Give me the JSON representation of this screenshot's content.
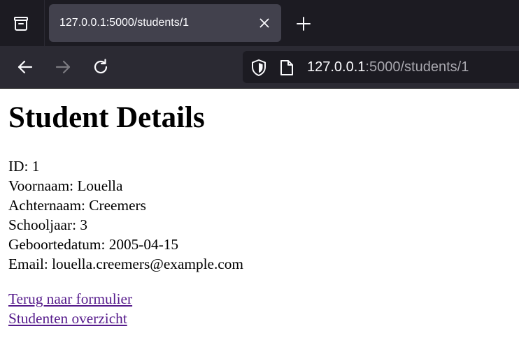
{
  "browser": {
    "tab_title": "127.0.0.1:5000/students/1",
    "url_host": "127.0.0.1",
    "url_path": ":5000/students/1",
    "icons": {
      "tab_list": "tab-list-icon",
      "close": "close-icon",
      "new_tab": "plus-icon",
      "back": "back-arrow-icon",
      "forward": "forward-arrow-icon",
      "reload": "reload-icon",
      "shield": "shield-icon",
      "page": "page-icon"
    },
    "colors": {
      "tabbar": "#1c1b22",
      "navbar": "#2b2a33",
      "active_tab": "#42414d"
    }
  },
  "page": {
    "title": "Student Details",
    "fields": {
      "id": "ID: 1",
      "voornaam": "Voornaam: Louella",
      "achternaam": "Achternaam: Creemers",
      "schooljaar": "Schooljaar: 3",
      "geboortedatum": "Geboortedatum: 2005-04-15",
      "email": "Email: louella.creemers@example.com"
    },
    "links": {
      "back_to_form": "Terug naar formulier",
      "overview": "Studenten overzicht"
    },
    "colors": {
      "link_visited": "#551a8b"
    }
  }
}
